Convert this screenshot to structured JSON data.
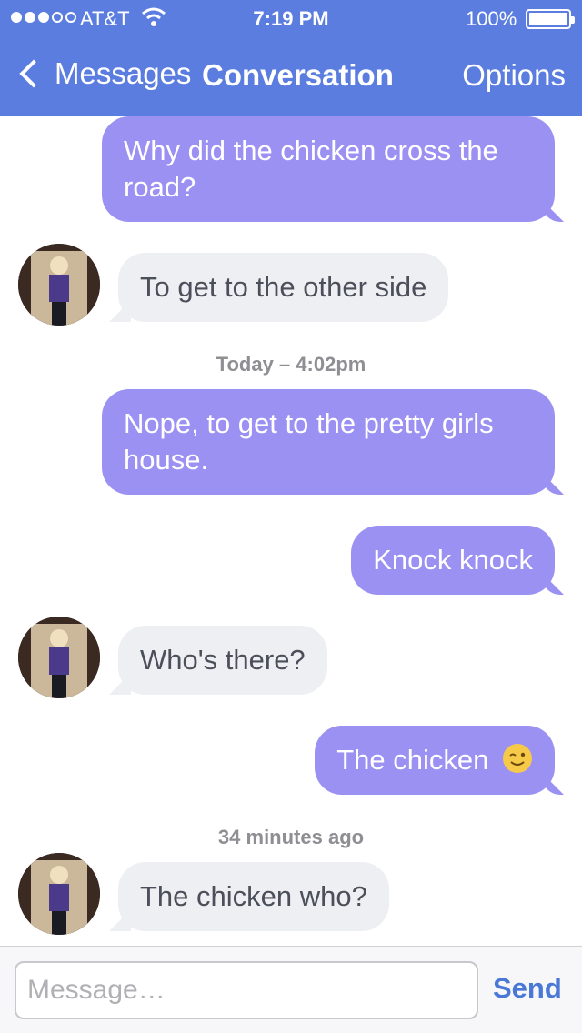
{
  "status": {
    "carrier": "AT&T",
    "time": "7:19 PM",
    "battery": "100%",
    "signal_bars": 3
  },
  "nav": {
    "back_label": "Messages",
    "title": "Conversation",
    "options_label": "Options"
  },
  "colors": {
    "navbar": "#5b7de0",
    "outgoing": "#9b91f3",
    "incoming": "#eeeff2",
    "send": "#4a78d6"
  },
  "messages": [
    {
      "from": "me",
      "text": "Why did the chicken cross the road?"
    },
    {
      "from": "them",
      "text": "To get to the other side",
      "avatar": "avatar-photo"
    },
    {
      "type": "timestamp",
      "text": "Today – 4:02pm"
    },
    {
      "from": "me",
      "text": "Nope, to get to the pretty girls house."
    },
    {
      "from": "me",
      "text": "Knock knock"
    },
    {
      "from": "them",
      "text": "Who's there?",
      "avatar": "avatar-photo"
    },
    {
      "from": "me",
      "text": "The chicken",
      "emoji": "winking-face-emoji"
    },
    {
      "type": "timestamp",
      "text": "34 minutes ago"
    },
    {
      "from": "them",
      "text": "The chicken who?",
      "avatar": "avatar-photo"
    }
  ],
  "composer": {
    "placeholder": "Message…",
    "send_label": "Send"
  }
}
